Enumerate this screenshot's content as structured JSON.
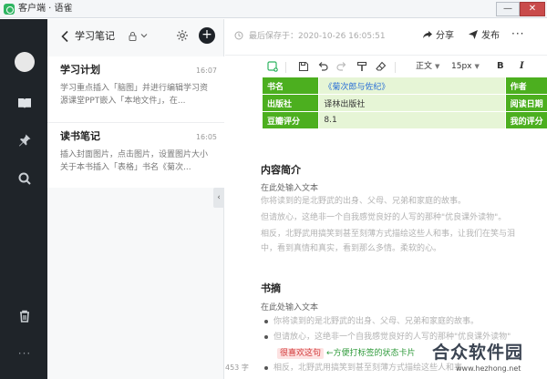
{
  "window": {
    "title": "客户端 · 语雀",
    "min": "—",
    "max": "▢",
    "close": "✕"
  },
  "notebook": {
    "title": "学习笔记",
    "add": "+"
  },
  "notes": [
    {
      "title": "学习计划",
      "time": "16:07",
      "snippet": "学习重点插入「脑图」并进行编辑学习资源课堂PPT嵌入「本地文件」，在..."
    },
    {
      "title": "读书笔记",
      "time": "16:05",
      "snippet": "插入封面图片，点击图片，设置图片大小关于本书插入「表格」书名《菊次..."
    }
  ],
  "editor": {
    "saved": "最后保存于：2020-10-26 16:05:51",
    "share": "分享",
    "publish": "发布",
    "more": "···",
    "font_style": "正文",
    "font_size": "15px",
    "bold": "B",
    "italic": "I",
    "word_count": "453 字"
  },
  "book_table": {
    "rows": [
      {
        "k1": "书名",
        "v1": "《菊次郎与佐纪》",
        "k2": "作者"
      },
      {
        "k1": "出版社",
        "v1": "译林出版社",
        "k2": "阅读日期"
      },
      {
        "k1": "豆瓣评分",
        "v1": "8.1",
        "k2": "我的评分"
      }
    ]
  },
  "intro": {
    "title": "内容简介",
    "hint": "在此处输入文本",
    "lines": [
      "你将读到的是北野武的出身、父母、兄弟和家庭的故事。",
      "但请放心，这绝非一个自我感觉良好的人写的那种\"优良课外读物\"。",
      "相反，北野武用搞笑到甚至刻薄方式描绘这些人和事，让我们在笑与泪",
      "中，看到真情和真实，看到那么多情。柔软的心。"
    ]
  },
  "excerpt": {
    "title": "书摘",
    "hint": "在此处输入文本",
    "bullets": [
      "你将读到的是北野武的出身、父母、兄弟和家庭的故事。",
      "但请放心，这绝非一个自我感觉良好的人写的那种\"优良课外读物\"",
      "相反，北野武用搞笑到甚至刻薄方式描绘这些人和事"
    ],
    "status_card": "很喜欢这句",
    "status_note": "←方便打标签的状态卡片"
  },
  "watermark": {
    "text": "合众软件园",
    "url": "www.hezhong.net"
  }
}
